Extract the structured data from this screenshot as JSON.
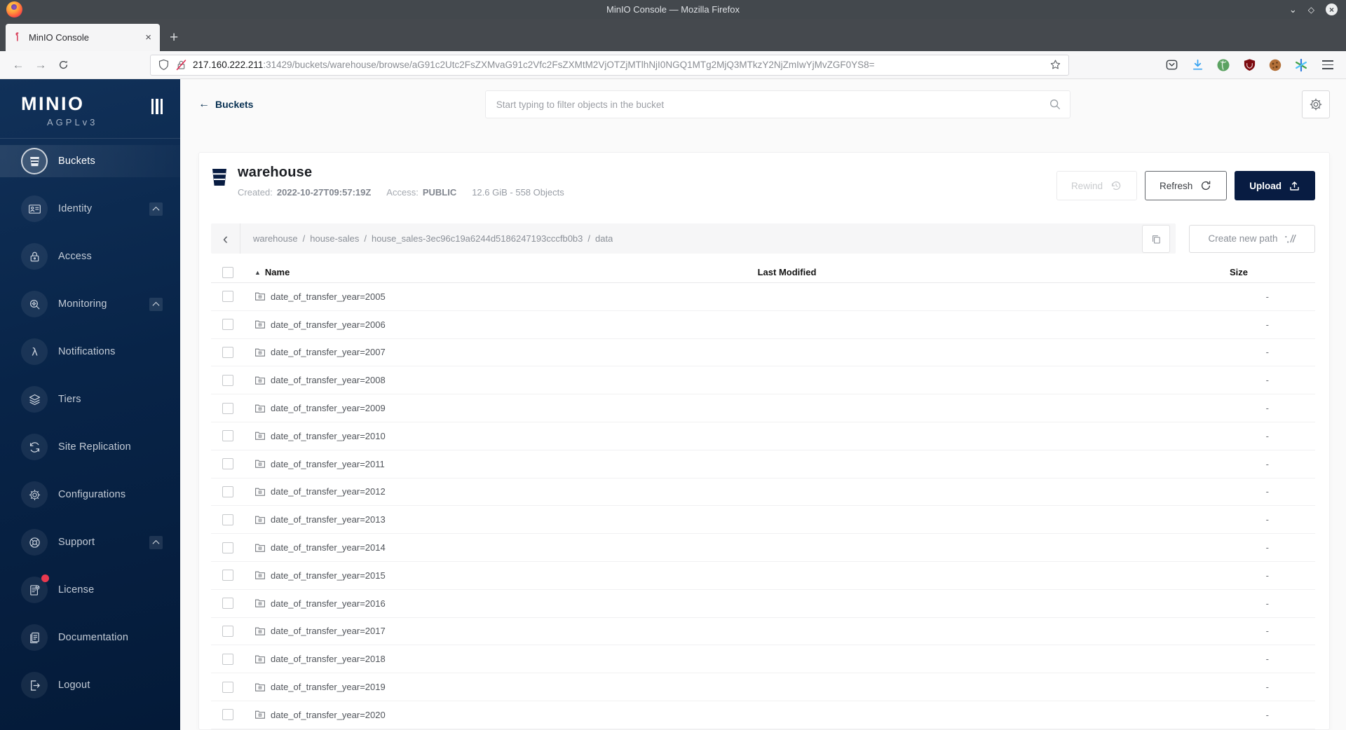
{
  "browser": {
    "window_title": "MinIO Console — Mozilla Firefox",
    "tab_title": "MinIO Console",
    "url_host": "217.160.222.211",
    "url_path": ":31429/buckets/warehouse/browse/aG91c2Utc2FsZXMvaG91c2Vfc2FsZXMtM2VjOTZjMTlhNjI0NGQ1MTg2MjQ3MTkzY2NjZmIwYjMvZGF0YS8="
  },
  "icons_text": {
    "back": "←",
    "forward": "→",
    "new_tab": "+",
    "close_tab": "×",
    "minimize": "⌄",
    "maximize": "◇",
    "close_window": "×",
    "sort_asc": "▲",
    "chevron_left": "‹",
    "crumb_separator": "/"
  },
  "sidebar": {
    "logo": "MINIO",
    "logo_sub": "AGPLv3",
    "items": [
      {
        "label": "Buckets",
        "icon": "bucket",
        "selected": true
      },
      {
        "label": "Identity",
        "icon": "identity",
        "expandable": true
      },
      {
        "label": "Access",
        "icon": "access"
      },
      {
        "label": "Monitoring",
        "icon": "monitoring",
        "expandable": true
      },
      {
        "label": "Notifications",
        "icon": "notifications"
      },
      {
        "label": "Tiers",
        "icon": "tiers"
      },
      {
        "label": "Site Replication",
        "icon": "replication"
      },
      {
        "label": "Configurations",
        "icon": "configurations"
      },
      {
        "label": "Support",
        "icon": "support",
        "expandable": true
      },
      {
        "label": "License",
        "icon": "license",
        "badge": true
      },
      {
        "label": "Documentation",
        "icon": "documentation"
      },
      {
        "label": "Logout",
        "icon": "logout",
        "gap_before": true
      }
    ]
  },
  "header": {
    "back_label": "Buckets",
    "search_placeholder": "Start typing to filter objects in the bucket"
  },
  "bucket": {
    "name": "warehouse",
    "created_label": "Created:",
    "created_value": "2022-10-27T09:57:19Z",
    "access_label": "Access:",
    "access_value": "PUBLIC",
    "summary": "12.6 GiB - 558 Objects",
    "rewind_label": "Rewind",
    "refresh_label": "Refresh",
    "upload_label": "Upload"
  },
  "browse": {
    "breadcrumb": [
      "warehouse",
      "house-sales",
      "house_sales-3ec96c19a6244d5186247193cccfb0b3",
      "data"
    ],
    "create_path_label": "Create new path",
    "columns": {
      "name": "Name",
      "last_modified": "Last Modified",
      "size": "Size"
    },
    "rows": [
      {
        "name": "date_of_transfer_year=2005",
        "size": "-"
      },
      {
        "name": "date_of_transfer_year=2006",
        "size": "-"
      },
      {
        "name": "date_of_transfer_year=2007",
        "size": "-"
      },
      {
        "name": "date_of_transfer_year=2008",
        "size": "-"
      },
      {
        "name": "date_of_transfer_year=2009",
        "size": "-"
      },
      {
        "name": "date_of_transfer_year=2010",
        "size": "-"
      },
      {
        "name": "date_of_transfer_year=2011",
        "size": "-"
      },
      {
        "name": "date_of_transfer_year=2012",
        "size": "-"
      },
      {
        "name": "date_of_transfer_year=2013",
        "size": "-"
      },
      {
        "name": "date_of_transfer_year=2014",
        "size": "-"
      },
      {
        "name": "date_of_transfer_year=2015",
        "size": "-"
      },
      {
        "name": "date_of_transfer_year=2016",
        "size": "-"
      },
      {
        "name": "date_of_transfer_year=2017",
        "size": "-"
      },
      {
        "name": "date_of_transfer_year=2018",
        "size": "-"
      },
      {
        "name": "date_of_transfer_year=2019",
        "size": "-"
      },
      {
        "name": "date_of_transfer_year=2020",
        "size": "-"
      }
    ]
  },
  "colors": {
    "brand_navy": "#081C42",
    "sidebar_navy_top": "#113159",
    "sidebar_navy_bottom": "#041a38",
    "license_badge_red": "#e8394f",
    "download_blue": "#38a3f1",
    "ublock_red": "#7c0b10",
    "titlebar_gray": "#43484d"
  }
}
